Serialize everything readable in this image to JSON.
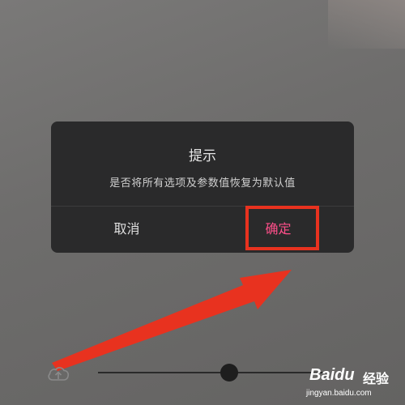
{
  "dialog": {
    "title": "提示",
    "message": "是否将所有选项及参数值恢复为默认值",
    "cancel_label": "取消",
    "confirm_label": "确定"
  },
  "colors": {
    "dialog_bg": "#2a2a2b",
    "confirm_accent": "#ff4f8a",
    "annotation_red": "#e8321f"
  },
  "annotation": {
    "arrow_icon": "red-arrow-icon",
    "box": "red-highlight-box"
  },
  "slider": {
    "level": 0.58
  },
  "watermark": {
    "brand": "Baidu",
    "text": "经验",
    "url": "jingyan.baidu.com"
  }
}
